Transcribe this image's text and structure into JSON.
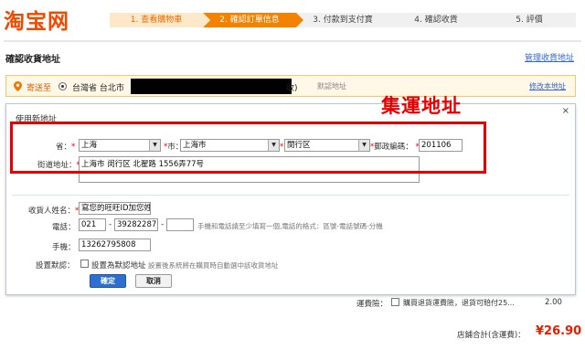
{
  "logo": "淘宝网",
  "steps": [
    {
      "label": "1. 查看購物車",
      "state": "done"
    },
    {
      "label": "2. 確認訂單信息",
      "state": "active"
    },
    {
      "label": "3. 付款到支付寶",
      "state": "todo"
    },
    {
      "label": "4. 確認收貨",
      "state": "todo"
    },
    {
      "label": "5. 評價",
      "state": "todo"
    }
  ],
  "address_section": {
    "title": "確認收貨地址",
    "manage_link": "管理收貨地址",
    "ship_to_label": "寄送至",
    "current_address_prefix": "台灣省 台北市",
    "current_address_suffix": "收)",
    "default_tag": "默認地址",
    "edit_link": "修改本地址"
  },
  "annotation": "集運地址",
  "dialog": {
    "title": "使用新地址",
    "close": "×",
    "province_label": "省：",
    "province_value": "上海",
    "city_label": "市：",
    "city_value": "上海市",
    "district_label": "區：",
    "district_value": "閔行区",
    "zip_label": "郵政編碼：",
    "zip_value": "201106",
    "street_label": "街道地址：",
    "street_value": "上海市 闵行区 北翟路 1556弄77号",
    "name_label": "收貨人姓名：",
    "name_value": "寫您的旺旺ID加您姓名",
    "phone_label": "電話：",
    "phone_area": "021",
    "phone_number": "39282287",
    "phone_ext": "",
    "phone_hint": "手機和電話請至少填寫一個,電話的格式：區號-電話號碼-分機",
    "mobile_label": "手機：",
    "mobile_value": "13262795808",
    "default_label": "設置默認：",
    "default_checkbox_text": "設置為默認地址",
    "default_hint": "設置後系統將在購買時自動選中該收貨地址",
    "confirm_button": "確定",
    "cancel_button": "取消"
  },
  "freight": {
    "label": "運費險：",
    "text": "購買退貨運費險，退貨可賠付25...",
    "value": "2.00"
  },
  "total": {
    "label": "店鋪合計(含運費)：",
    "value": "¥26.90"
  }
}
